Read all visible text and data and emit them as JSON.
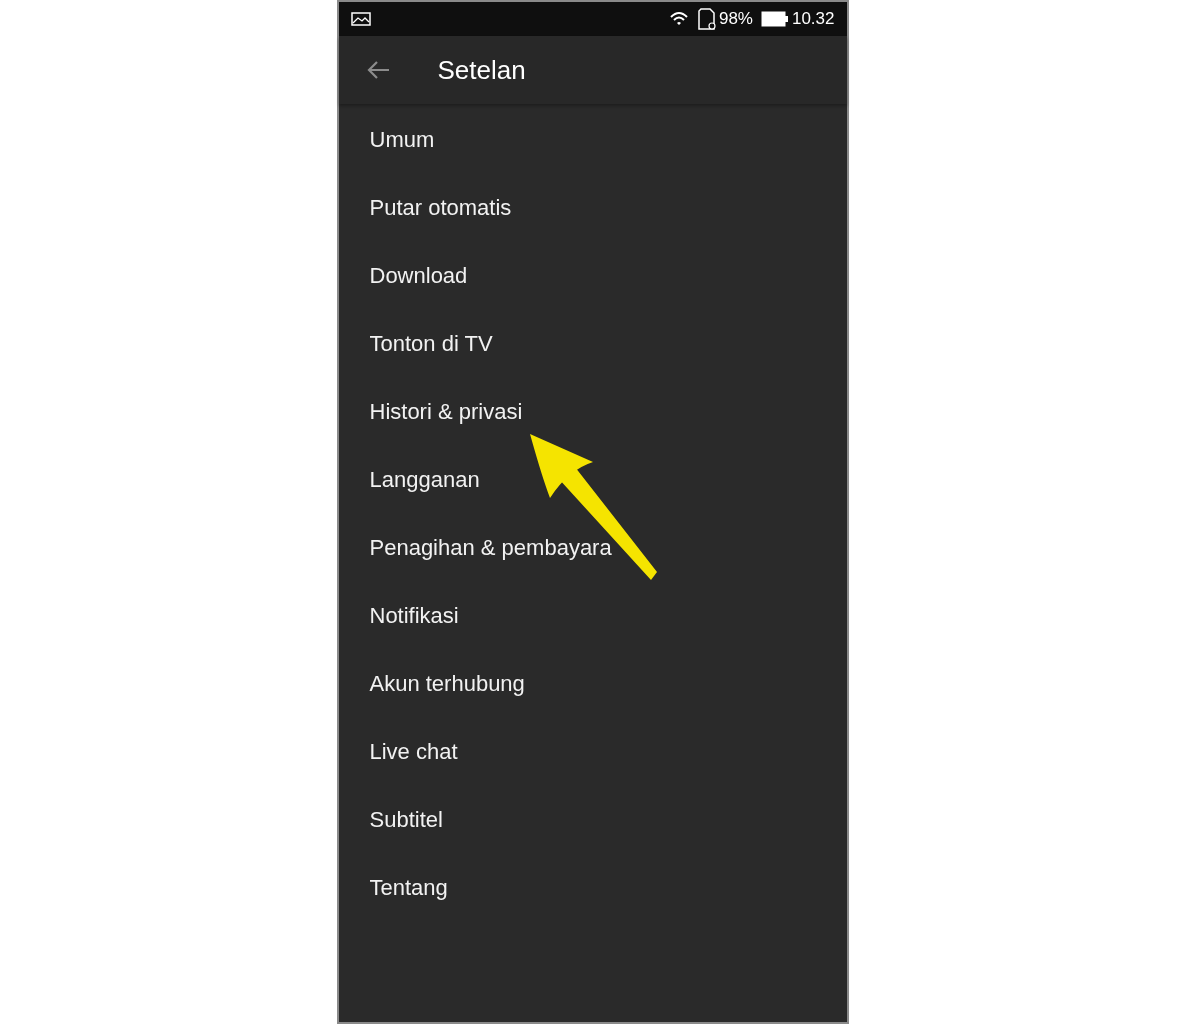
{
  "status_bar": {
    "battery": "98%",
    "time": "10.32"
  },
  "header": {
    "title": "Setelan"
  },
  "menu_items": [
    {
      "label": "Umum"
    },
    {
      "label": "Putar otomatis"
    },
    {
      "label": "Download"
    },
    {
      "label": "Tonton di TV"
    },
    {
      "label": "Histori & privasi"
    },
    {
      "label": "Langganan"
    },
    {
      "label": "Penagihan & pembayara"
    },
    {
      "label": "Notifikasi"
    },
    {
      "label": "Akun terhubung"
    },
    {
      "label": "Live chat"
    },
    {
      "label": "Subtitel"
    },
    {
      "label": "Tentang"
    }
  ]
}
